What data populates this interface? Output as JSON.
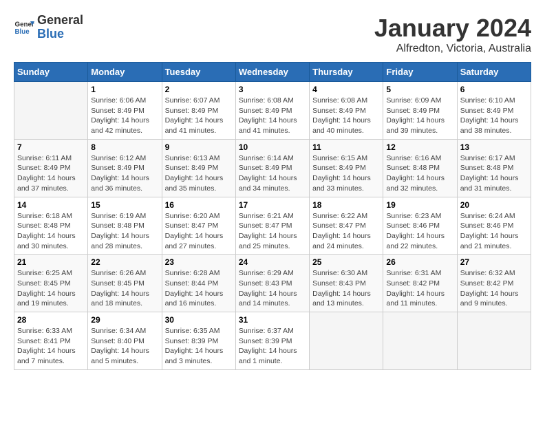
{
  "logo": {
    "general": "General",
    "blue": "Blue"
  },
  "title": "January 2024",
  "subtitle": "Alfredton, Victoria, Australia",
  "days_of_week": [
    "Sunday",
    "Monday",
    "Tuesday",
    "Wednesday",
    "Thursday",
    "Friday",
    "Saturday"
  ],
  "weeks": [
    [
      {
        "day": "",
        "info": ""
      },
      {
        "day": "1",
        "info": "Sunrise: 6:06 AM\nSunset: 8:49 PM\nDaylight: 14 hours\nand 42 minutes."
      },
      {
        "day": "2",
        "info": "Sunrise: 6:07 AM\nSunset: 8:49 PM\nDaylight: 14 hours\nand 41 minutes."
      },
      {
        "day": "3",
        "info": "Sunrise: 6:08 AM\nSunset: 8:49 PM\nDaylight: 14 hours\nand 41 minutes."
      },
      {
        "day": "4",
        "info": "Sunrise: 6:08 AM\nSunset: 8:49 PM\nDaylight: 14 hours\nand 40 minutes."
      },
      {
        "day": "5",
        "info": "Sunrise: 6:09 AM\nSunset: 8:49 PM\nDaylight: 14 hours\nand 39 minutes."
      },
      {
        "day": "6",
        "info": "Sunrise: 6:10 AM\nSunset: 8:49 PM\nDaylight: 14 hours\nand 38 minutes."
      }
    ],
    [
      {
        "day": "7",
        "info": "Sunrise: 6:11 AM\nSunset: 8:49 PM\nDaylight: 14 hours\nand 37 minutes."
      },
      {
        "day": "8",
        "info": "Sunrise: 6:12 AM\nSunset: 8:49 PM\nDaylight: 14 hours\nand 36 minutes."
      },
      {
        "day": "9",
        "info": "Sunrise: 6:13 AM\nSunset: 8:49 PM\nDaylight: 14 hours\nand 35 minutes."
      },
      {
        "day": "10",
        "info": "Sunrise: 6:14 AM\nSunset: 8:49 PM\nDaylight: 14 hours\nand 34 minutes."
      },
      {
        "day": "11",
        "info": "Sunrise: 6:15 AM\nSunset: 8:49 PM\nDaylight: 14 hours\nand 33 minutes."
      },
      {
        "day": "12",
        "info": "Sunrise: 6:16 AM\nSunset: 8:48 PM\nDaylight: 14 hours\nand 32 minutes."
      },
      {
        "day": "13",
        "info": "Sunrise: 6:17 AM\nSunset: 8:48 PM\nDaylight: 14 hours\nand 31 minutes."
      }
    ],
    [
      {
        "day": "14",
        "info": "Sunrise: 6:18 AM\nSunset: 8:48 PM\nDaylight: 14 hours\nand 30 minutes."
      },
      {
        "day": "15",
        "info": "Sunrise: 6:19 AM\nSunset: 8:48 PM\nDaylight: 14 hours\nand 28 minutes."
      },
      {
        "day": "16",
        "info": "Sunrise: 6:20 AM\nSunset: 8:47 PM\nDaylight: 14 hours\nand 27 minutes."
      },
      {
        "day": "17",
        "info": "Sunrise: 6:21 AM\nSunset: 8:47 PM\nDaylight: 14 hours\nand 25 minutes."
      },
      {
        "day": "18",
        "info": "Sunrise: 6:22 AM\nSunset: 8:47 PM\nDaylight: 14 hours\nand 24 minutes."
      },
      {
        "day": "19",
        "info": "Sunrise: 6:23 AM\nSunset: 8:46 PM\nDaylight: 14 hours\nand 22 minutes."
      },
      {
        "day": "20",
        "info": "Sunrise: 6:24 AM\nSunset: 8:46 PM\nDaylight: 14 hours\nand 21 minutes."
      }
    ],
    [
      {
        "day": "21",
        "info": "Sunrise: 6:25 AM\nSunset: 8:45 PM\nDaylight: 14 hours\nand 19 minutes."
      },
      {
        "day": "22",
        "info": "Sunrise: 6:26 AM\nSunset: 8:45 PM\nDaylight: 14 hours\nand 18 minutes."
      },
      {
        "day": "23",
        "info": "Sunrise: 6:28 AM\nSunset: 8:44 PM\nDaylight: 14 hours\nand 16 minutes."
      },
      {
        "day": "24",
        "info": "Sunrise: 6:29 AM\nSunset: 8:43 PM\nDaylight: 14 hours\nand 14 minutes."
      },
      {
        "day": "25",
        "info": "Sunrise: 6:30 AM\nSunset: 8:43 PM\nDaylight: 14 hours\nand 13 minutes."
      },
      {
        "day": "26",
        "info": "Sunrise: 6:31 AM\nSunset: 8:42 PM\nDaylight: 14 hours\nand 11 minutes."
      },
      {
        "day": "27",
        "info": "Sunrise: 6:32 AM\nSunset: 8:42 PM\nDaylight: 14 hours\nand 9 minutes."
      }
    ],
    [
      {
        "day": "28",
        "info": "Sunrise: 6:33 AM\nSunset: 8:41 PM\nDaylight: 14 hours\nand 7 minutes."
      },
      {
        "day": "29",
        "info": "Sunrise: 6:34 AM\nSunset: 8:40 PM\nDaylight: 14 hours\nand 5 minutes."
      },
      {
        "day": "30",
        "info": "Sunrise: 6:35 AM\nSunset: 8:39 PM\nDaylight: 14 hours\nand 3 minutes."
      },
      {
        "day": "31",
        "info": "Sunrise: 6:37 AM\nSunset: 8:39 PM\nDaylight: 14 hours\nand 1 minute."
      },
      {
        "day": "",
        "info": ""
      },
      {
        "day": "",
        "info": ""
      },
      {
        "day": "",
        "info": ""
      }
    ]
  ]
}
